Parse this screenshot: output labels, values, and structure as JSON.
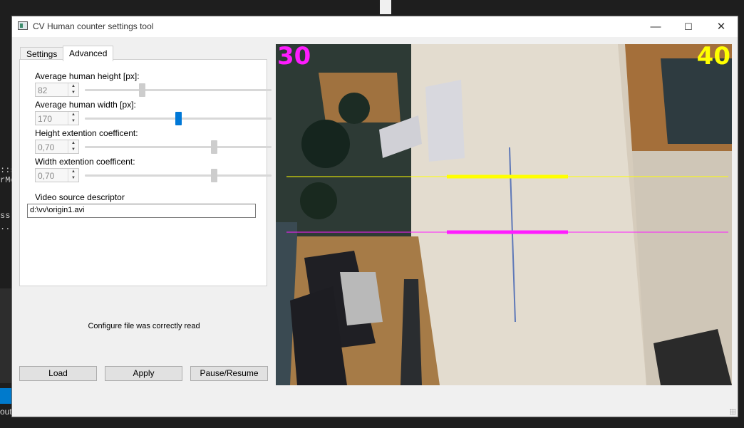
{
  "window": {
    "title": "CV Human counter settings tool",
    "controls": {
      "minimize": "—",
      "maximize": "☐",
      "close": "✕"
    }
  },
  "tabs": [
    {
      "label": "Settings",
      "active": false
    },
    {
      "label": "Advanced",
      "active": true
    }
  ],
  "advanced": {
    "avg_height": {
      "label": "Average human height [px]:",
      "value": "82",
      "slider_fraction": 0.3
    },
    "avg_width": {
      "label": "Average human width [px]:",
      "value": "170",
      "slider_fraction": 0.5
    },
    "height_coef": {
      "label": "Height extention coefficent:",
      "value": "0,70",
      "slider_fraction": 0.7
    },
    "width_coef": {
      "label": "Width extention coefficent:",
      "value": "0,70",
      "slider_fraction": 0.7
    },
    "video_source": {
      "label": "Video source descriptor",
      "value": "d:\\vv\\origin1.avi"
    }
  },
  "status_message": "Configure file was correctly read",
  "buttons": {
    "load": "Load",
    "apply": "Apply",
    "pause_resume": "Pause/Resume"
  },
  "video": {
    "counter_left": "30",
    "counter_right": "40",
    "counter_left_color": "#ff1cff",
    "counter_right_color": "#ffff00",
    "line_top_color": "#ffff00",
    "line_bottom_color": "#ff1cff"
  },
  "background": {
    "terminal_lines": [
      "::s",
      "rMe",
      "ss:",
      "..."
    ],
    "out_text": "out"
  }
}
